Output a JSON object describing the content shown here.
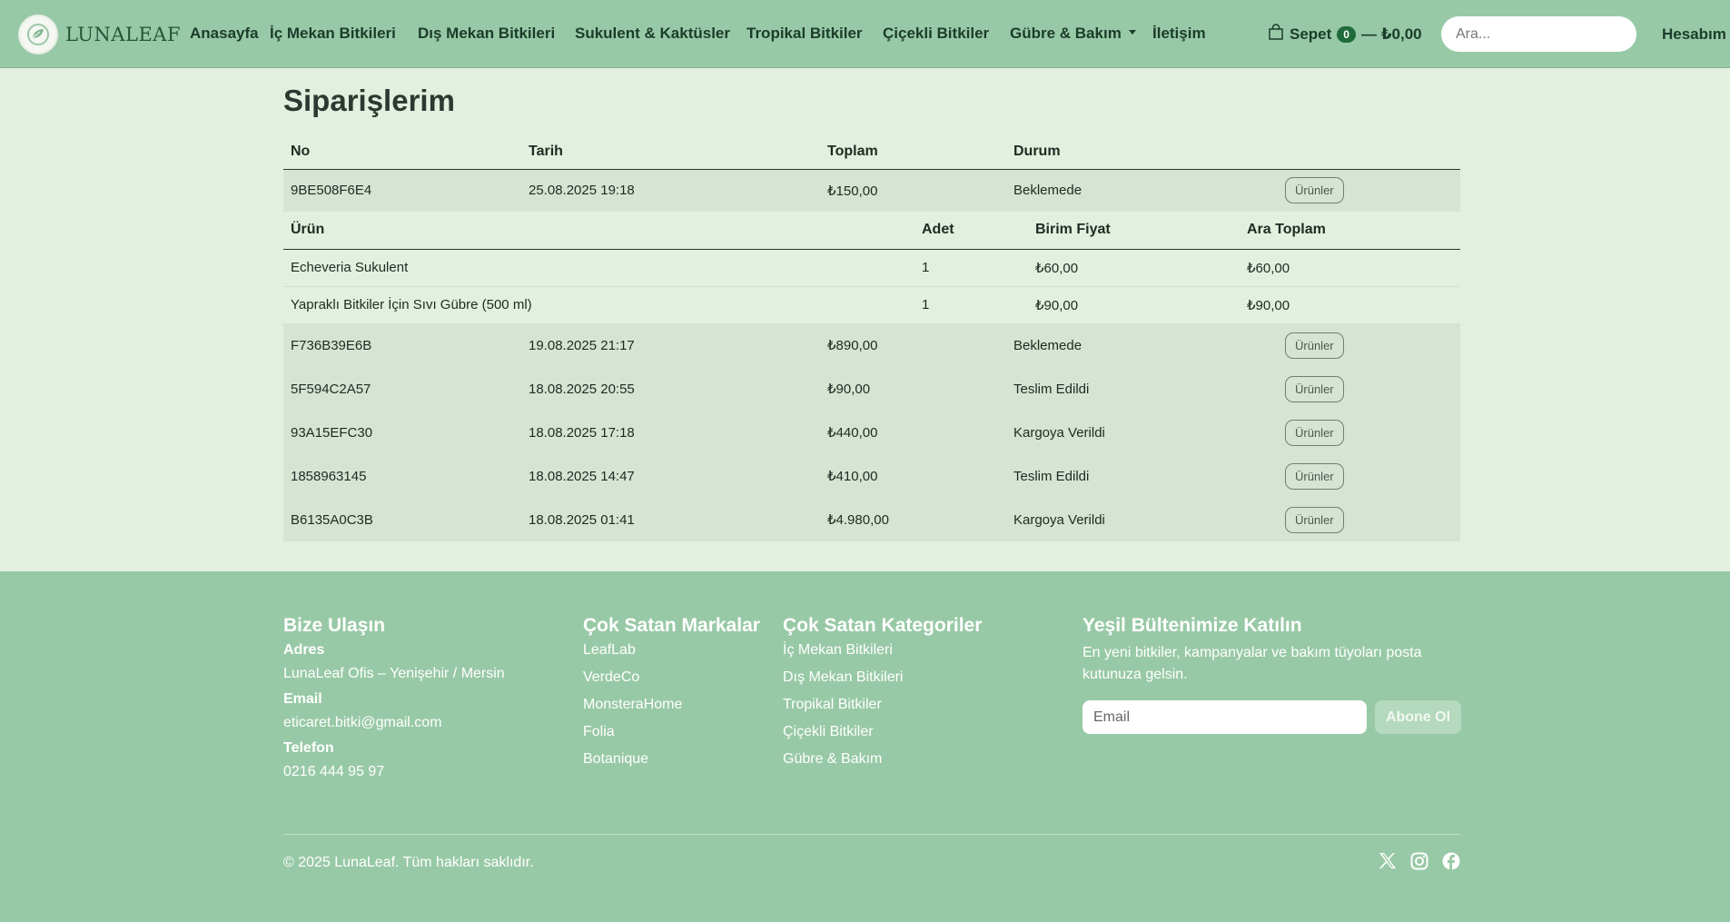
{
  "brand": {
    "name": "LUNALEAF",
    "logo_icon": "leaf-moon-icon"
  },
  "nav": {
    "home": "Anasayfa",
    "indoor": "İç Mekan Bitkileri",
    "outdoor": "Dış Mekan Bitkileri",
    "succulent": "Sukulent & Kaktüsler",
    "tropical": "Tropikal Bitkiler",
    "flowering": "Çiçekli Bitkiler",
    "fertilizer": "Gübre & Bakım",
    "contact": "İletişim"
  },
  "cart": {
    "label": "Sepet",
    "count": "0",
    "total": "— ₺0,00"
  },
  "search": {
    "placeholder": "Ara..."
  },
  "account": {
    "label": "Hesabım"
  },
  "page": {
    "title": "Siparişlerim"
  },
  "orders": {
    "headers": {
      "no": "No",
      "date": "Tarih",
      "total": "Toplam",
      "status": "Durum"
    },
    "button_label": "Ürünler",
    "rows": [
      {
        "no": "9BE508F6E4",
        "date": "25.08.2025 19:18",
        "total": "₺150,00",
        "status": "Beklemede"
      },
      {
        "no": "F736B39E6B",
        "date": "19.08.2025 21:17",
        "total": "₺890,00",
        "status": "Beklemede"
      },
      {
        "no": "5F594C2A57",
        "date": "18.08.2025 20:55",
        "total": "₺90,00",
        "status": "Teslim Edildi"
      },
      {
        "no": "93A15EFC30",
        "date": "18.08.2025 17:18",
        "total": "₺440,00",
        "status": "Kargoya Verildi"
      },
      {
        "no": "1858963145",
        "date": "18.08.2025 14:47",
        "total": "₺410,00",
        "status": "Teslim Edildi"
      },
      {
        "no": "B6135A0C3B",
        "date": "18.08.2025 01:41",
        "total": "₺4.980,00",
        "status": "Kargoya Verildi"
      }
    ],
    "detail": {
      "headers": {
        "product": "Ürün",
        "qty": "Adet",
        "unit_price": "Birim Fiyat",
        "subtotal": "Ara Toplam"
      },
      "items": [
        {
          "product": "Echeveria Sukulent",
          "qty": "1",
          "unit_price": "₺60,00",
          "subtotal": "₺60,00"
        },
        {
          "product": "Yapraklı Bitkiler İçin Sıvı Gübre (500 ml)",
          "qty": "1",
          "unit_price": "₺90,00",
          "subtotal": "₺90,00"
        }
      ]
    }
  },
  "footer": {
    "contact": {
      "title": "Bize Ulaşın",
      "address_label": "Adres",
      "address": "LunaLeaf Ofis – Yenişehir / Mersin",
      "email_label": "Email",
      "email": "eticaret.bitki@gmail.com",
      "phone_label": "Telefon",
      "phone": "0216 444 95 97"
    },
    "brands": {
      "title": "Çok Satan Markalar",
      "items": [
        "LeafLab",
        "VerdeCo",
        "MonsteraHome",
        "Folia",
        "Botanique"
      ]
    },
    "categories": {
      "title": "Çok Satan Kategoriler",
      "items": [
        "İç Mekan Bitkileri",
        "Dış Mekan Bitkileri",
        "Tropikal Bitkiler",
        "Çiçekli Bitkiler",
        "Gübre & Bakım"
      ]
    },
    "newsletter": {
      "title": "Yeşil Bültenimize Katılın",
      "description": "En yeni bitkiler, kampanyalar ve bakım tüyoları posta kutunuza gelsin.",
      "placeholder": "Email",
      "button": "Abone Ol"
    },
    "copyright": "© 2025 LunaLeaf. Tüm hakları saklıdır.",
    "social_icons": [
      "x-twitter-icon",
      "instagram-icon",
      "facebook-icon"
    ]
  },
  "colors": {
    "navbar_bg": "#98c9a6",
    "page_bg": "#e3efdf",
    "row_bg": "#d6e4d4",
    "badge": "#1f6b3a"
  }
}
